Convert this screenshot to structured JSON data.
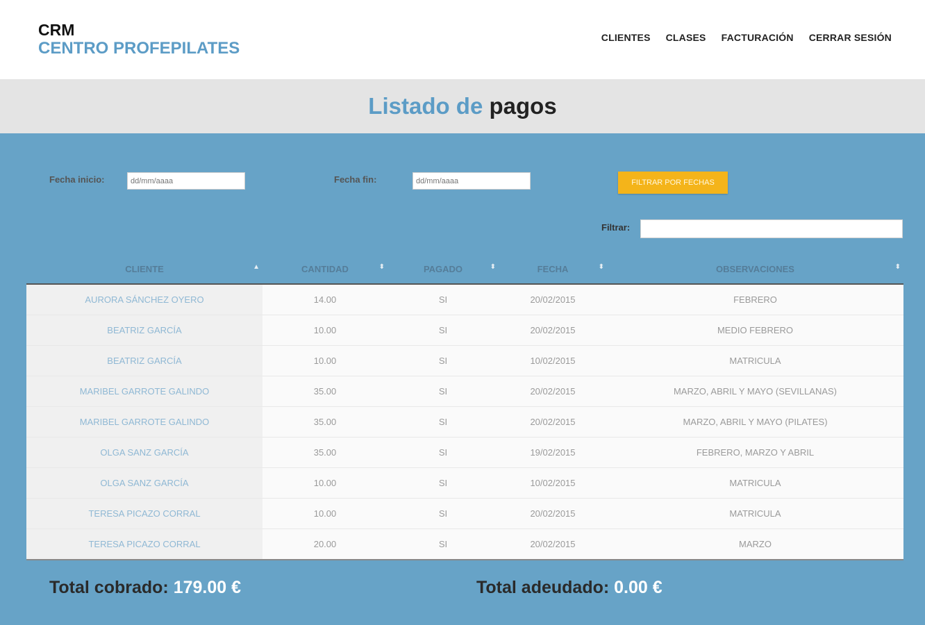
{
  "header": {
    "brand_line1": "CRM",
    "brand_line2": "CENTRO PROFEPILATES",
    "nav": [
      "CLIENTES",
      "CLASES",
      "FACTURACIÓN",
      "CERRAR SESIÓN"
    ]
  },
  "page": {
    "title_part1": "Listado de",
    "title_part2": "pagos"
  },
  "filters": {
    "start_label": "Fecha inicio:",
    "start_placeholder": "dd/mm/aaaa",
    "end_label": "Fecha fin:",
    "end_placeholder": "dd/mm/aaaa",
    "button_label": "FILTRAR POR FECHAS",
    "search_label": "Filtrar:",
    "search_value": ""
  },
  "table": {
    "columns": [
      "CLIENTE",
      "CANTIDAD",
      "PAGADO",
      "FECHA",
      "OBSERVACIONES"
    ],
    "rows": [
      [
        "AURORA SÁNCHEZ OYERO",
        "14.00",
        "SI",
        "20/02/2015",
        "FEBRERO"
      ],
      [
        "BEATRIZ GARCÍA",
        "10.00",
        "SI",
        "20/02/2015",
        "MEDIO FEBRERO"
      ],
      [
        "BEATRIZ GARCÍA",
        "10.00",
        "SI",
        "10/02/2015",
        "MATRICULA"
      ],
      [
        "MARIBEL GARROTE GALINDO",
        "35.00",
        "SI",
        "20/02/2015",
        "MARZO, ABRIL Y MAYO (SEVILLANAS)"
      ],
      [
        "MARIBEL GARROTE GALINDO",
        "35.00",
        "SI",
        "20/02/2015",
        "MARZO, ABRIL Y MAYO (PILATES)"
      ],
      [
        "OLGA SANZ GARCÍA",
        "35.00",
        "SI",
        "19/02/2015",
        "FEBRERO, MARZO Y ABRIL"
      ],
      [
        "OLGA SANZ GARCÍA",
        "10.00",
        "SI",
        "10/02/2015",
        "MATRICULA"
      ],
      [
        "TERESA PICAZO CORRAL",
        "10.00",
        "SI",
        "20/02/2015",
        "MATRICULA"
      ],
      [
        "TERESA PICAZO CORRAL",
        "20.00",
        "SI",
        "20/02/2015",
        "MARZO"
      ]
    ]
  },
  "totals": {
    "collected_label": "Total cobrado:",
    "collected_value": "179.00 €",
    "owed_label": "Total adeudado:",
    "owed_value": "0.00 €"
  },
  "icons": {
    "sort": "sort-icon"
  },
  "colors": {
    "accent": "#5c9cc6",
    "background": "#67a3c7",
    "button": "#f4b41a"
  }
}
